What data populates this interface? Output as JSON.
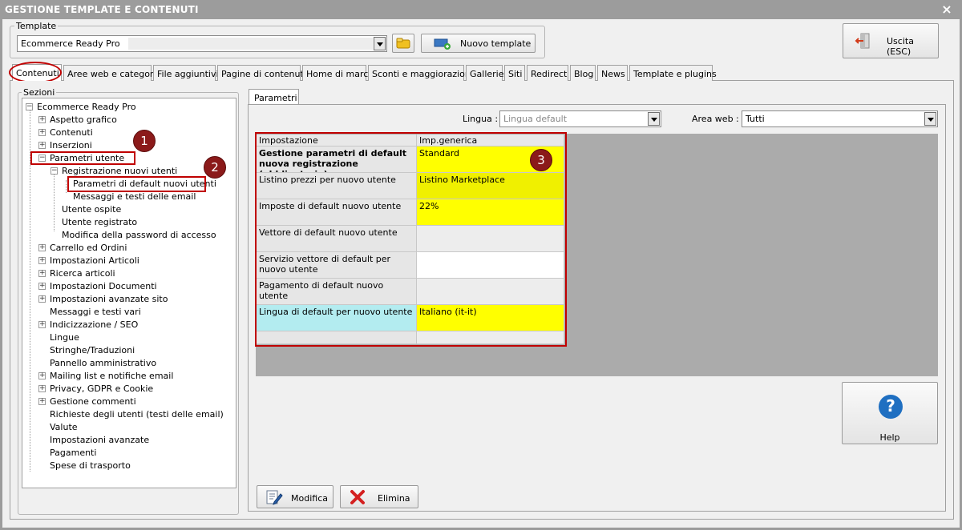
{
  "window": {
    "title": "GESTIONE TEMPLATE E CONTENUTI",
    "close_glyph": "×"
  },
  "template_group": {
    "label": "Template",
    "selected": "Ecommerce Ready Pro",
    "new_template_label": "Nuovo template"
  },
  "exit_button": {
    "label": "Uscita (ESC)"
  },
  "tabs": [
    "Contenuti",
    "Aree web e categorie",
    "File aggiuntivi",
    "Pagine di contenuti",
    "Home di marca",
    "Sconti e maggiorazioni",
    "Gallerie",
    "Siti",
    "Redirect",
    "Blog",
    "News",
    "Template e plugins"
  ],
  "sections": {
    "label": "Sezioni",
    "tree": [
      {
        "label": "Ecommerce Ready Pro",
        "toggle": "−"
      },
      {
        "label": "Aspetto grafico",
        "toggle": "+"
      },
      {
        "label": "Contenuti",
        "toggle": "+"
      },
      {
        "label": "Inserzioni",
        "toggle": "+"
      },
      {
        "label": "Parametri utente",
        "toggle": "−"
      },
      {
        "label": "Registrazione nuovi utenti",
        "toggle": "−"
      },
      {
        "label": "Parametri di default nuovi utenti",
        "toggle": ""
      },
      {
        "label": "Messaggi e testi delle email",
        "toggle": ""
      },
      {
        "label": "Utente ospite",
        "toggle": ""
      },
      {
        "label": "Utente registrato",
        "toggle": ""
      },
      {
        "label": "Modifica della password di accesso",
        "toggle": ""
      },
      {
        "label": "Carrello ed Ordini",
        "toggle": "+"
      },
      {
        "label": "Impostazioni Articoli",
        "toggle": "+"
      },
      {
        "label": "Ricerca articoli",
        "toggle": "+"
      },
      {
        "label": "Impostazioni Documenti",
        "toggle": "+"
      },
      {
        "label": "Impostazioni avanzate sito",
        "toggle": "+"
      },
      {
        "label": "Messaggi e testi vari",
        "toggle": ""
      },
      {
        "label": "Indicizzazione / SEO",
        "toggle": "+"
      },
      {
        "label": "Lingue",
        "toggle": ""
      },
      {
        "label": "Stringhe/Traduzioni",
        "toggle": ""
      },
      {
        "label": "Pannello amministrativo",
        "toggle": ""
      },
      {
        "label": "Mailing list e notifiche email",
        "toggle": "+"
      },
      {
        "label": "Privacy, GDPR e Cookie",
        "toggle": "+"
      },
      {
        "label": "Gestione commenti",
        "toggle": "+"
      },
      {
        "label": "Richieste degli utenti (testi delle email)",
        "toggle": ""
      },
      {
        "label": "Valute",
        "toggle": ""
      },
      {
        "label": "Impostazioni avanzate",
        "toggle": ""
      },
      {
        "label": "Pagamenti",
        "toggle": ""
      },
      {
        "label": "Spese di trasporto",
        "toggle": ""
      }
    ]
  },
  "params_tab": {
    "label": "Parametri"
  },
  "filters": {
    "language_label": "Lingua :",
    "language_value": "Lingua default",
    "area_label": "Area web :",
    "area_value": "Tutti"
  },
  "grid": {
    "headers": [
      "Impostazione",
      "Imp.generica"
    ],
    "rows": [
      {
        "setting": "Gestione parametri di default nuova registrazione (obbligatorio)",
        "value": "Standard"
      },
      {
        "setting": "Listino prezzi per nuovo utente",
        "value": "Listino Marketplace"
      },
      {
        "setting": "Imposte di default nuovo utente",
        "value": "22%"
      },
      {
        "setting": "Vettore di default nuovo utente",
        "value": ""
      },
      {
        "setting": "Servizio vettore di default per nuovo utente",
        "value": ""
      },
      {
        "setting": "Pagamento di default nuovo utente",
        "value": ""
      },
      {
        "setting": "Lingua di default per nuovo utente",
        "value": "Italiano (it-it)"
      }
    ]
  },
  "help_button": {
    "label": "Help",
    "glyph": "?"
  },
  "actions": {
    "edit_label": "Modifica",
    "delete_label": "Elimina"
  },
  "callouts": [
    "1",
    "2",
    "3"
  ],
  "colors": {
    "highlight": "#ffff00",
    "selected_row": "#b3ecf0",
    "annotation_red": "#c00000",
    "title_bar": "#9c9c9c"
  }
}
